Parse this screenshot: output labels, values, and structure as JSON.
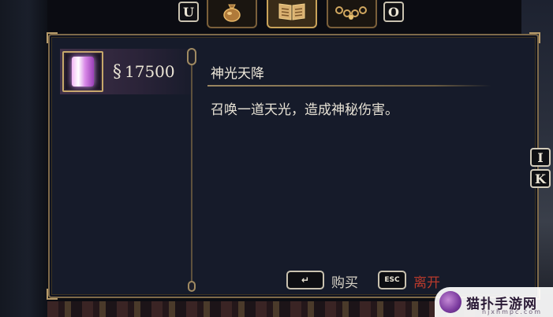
{
  "tabbar": {
    "left_key": "U",
    "right_key": "O",
    "tabs": [
      {
        "icon": "coin-bag-icon"
      },
      {
        "icon": "open-book-icon",
        "active": true
      },
      {
        "icon": "chain-necklace-icon"
      }
    ]
  },
  "shop": {
    "items": [
      {
        "icon": "light-crystal-icon",
        "price_icon": "currency-icon",
        "price_symbol": "§",
        "price": "17500"
      }
    ]
  },
  "detail": {
    "title": "神光天降",
    "description": "召唤一道天光，造成神秘伤害。"
  },
  "side_keys": [
    "I",
    "K"
  ],
  "actions": {
    "buy": {
      "key_icon": "enter-key-icon",
      "key_glyph": "↵",
      "label": "购买",
      "color": "#d8d3c6"
    },
    "leave": {
      "key": "ESC",
      "label": "离开",
      "color": "#b83a2c"
    }
  },
  "watermark": {
    "text": "猫扑手游网",
    "sub": "njxhmpc.com"
  }
}
